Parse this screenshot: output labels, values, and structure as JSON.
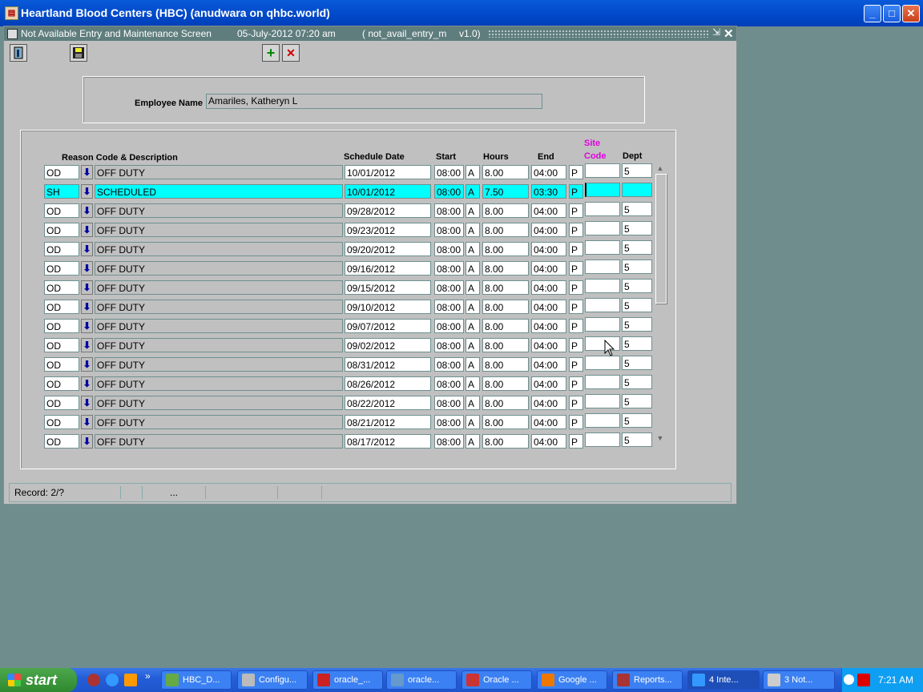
{
  "app": {
    "title": "Heartland Blood Centers (HBC) (anudwara on qhbc.world)",
    "min": "_",
    "max": "□",
    "close": "✕"
  },
  "window": {
    "screen_title": "Not Available Entry and Maintenance Screen",
    "datetime": "05-July-2012 07:20 am",
    "form_id": "( not_avail_entry_m",
    "version": "v1.0)",
    "min": "⇲",
    "close": "✕"
  },
  "toolbar": {
    "exit_icon": "exit-icon",
    "save_icon": "save-icon",
    "add": "+",
    "delete": "✕"
  },
  "employee": {
    "label": "Employee Name",
    "value": "Amariles, Katheryn L"
  },
  "headers": {
    "reason": "Reason Code & Description",
    "schedule_date": "Schedule Date",
    "start": "Start",
    "hours": "Hours",
    "end": "End",
    "site_line1": "Site",
    "site_line2": "Code",
    "dept": "Dept"
  },
  "lov_glyph": "⬇",
  "rows": [
    {
      "code": "OD",
      "desc": "OFF DUTY",
      "date": "10/01/2012",
      "start": "08:00",
      "ampm": "A",
      "hours": "8.00",
      "end": "04:00",
      "ep": "P",
      "site": "",
      "dept": "5"
    },
    {
      "code": "SH",
      "desc": "SCHEDULED",
      "date": "10/01/2012",
      "start": "08:00",
      "ampm": "A",
      "hours": "7.50",
      "end": "03:30",
      "ep": "P",
      "site": "",
      "dept": ""
    },
    {
      "code": "OD",
      "desc": "OFF DUTY",
      "date": "09/28/2012",
      "start": "08:00",
      "ampm": "A",
      "hours": "8.00",
      "end": "04:00",
      "ep": "P",
      "site": "",
      "dept": "5"
    },
    {
      "code": "OD",
      "desc": "OFF DUTY",
      "date": "09/23/2012",
      "start": "08:00",
      "ampm": "A",
      "hours": "8.00",
      "end": "04:00",
      "ep": "P",
      "site": "",
      "dept": "5"
    },
    {
      "code": "OD",
      "desc": "OFF DUTY",
      "date": "09/20/2012",
      "start": "08:00",
      "ampm": "A",
      "hours": "8.00",
      "end": "04:00",
      "ep": "P",
      "site": "",
      "dept": "5"
    },
    {
      "code": "OD",
      "desc": "OFF DUTY",
      "date": "09/16/2012",
      "start": "08:00",
      "ampm": "A",
      "hours": "8.00",
      "end": "04:00",
      "ep": "P",
      "site": "",
      "dept": "5"
    },
    {
      "code": "OD",
      "desc": "OFF DUTY",
      "date": "09/15/2012",
      "start": "08:00",
      "ampm": "A",
      "hours": "8.00",
      "end": "04:00",
      "ep": "P",
      "site": "",
      "dept": "5"
    },
    {
      "code": "OD",
      "desc": "OFF DUTY",
      "date": "09/10/2012",
      "start": "08:00",
      "ampm": "A",
      "hours": "8.00",
      "end": "04:00",
      "ep": "P",
      "site": "",
      "dept": "5"
    },
    {
      "code": "OD",
      "desc": "OFF DUTY",
      "date": "09/07/2012",
      "start": "08:00",
      "ampm": "A",
      "hours": "8.00",
      "end": "04:00",
      "ep": "P",
      "site": "",
      "dept": "5"
    },
    {
      "code": "OD",
      "desc": "OFF DUTY",
      "date": "09/02/2012",
      "start": "08:00",
      "ampm": "A",
      "hours": "8.00",
      "end": "04:00",
      "ep": "P",
      "site": "",
      "dept": "5"
    },
    {
      "code": "OD",
      "desc": "OFF DUTY",
      "date": "08/31/2012",
      "start": "08:00",
      "ampm": "A",
      "hours": "8.00",
      "end": "04:00",
      "ep": "P",
      "site": "",
      "dept": "5"
    },
    {
      "code": "OD",
      "desc": "OFF DUTY",
      "date": "08/26/2012",
      "start": "08:00",
      "ampm": "A",
      "hours": "8.00",
      "end": "04:00",
      "ep": "P",
      "site": "",
      "dept": "5"
    },
    {
      "code": "OD",
      "desc": "OFF DUTY",
      "date": "08/22/2012",
      "start": "08:00",
      "ampm": "A",
      "hours": "8.00",
      "end": "04:00",
      "ep": "P",
      "site": "",
      "dept": "5"
    },
    {
      "code": "OD",
      "desc": "OFF DUTY",
      "date": "08/21/2012",
      "start": "08:00",
      "ampm": "A",
      "hours": "8.00",
      "end": "04:00",
      "ep": "P",
      "site": "",
      "dept": "5"
    },
    {
      "code": "OD",
      "desc": "OFF DUTY",
      "date": "08/17/2012",
      "start": "08:00",
      "ampm": "A",
      "hours": "8.00",
      "end": "04:00",
      "ep": "P",
      "site": "",
      "dept": "5"
    }
  ],
  "scroll": {
    "up": "▲",
    "down": "▼"
  },
  "status": {
    "record": "Record: 2/?",
    "ellipsis": "..."
  },
  "taskbar": {
    "start": "start",
    "chevron": "»",
    "tasks": [
      "HBC_D...",
      "Configu...",
      "oracle_...",
      "oracle...",
      "Oracle ...",
      "Google ...",
      "Reports...",
      "4 Inte...",
      "3 Not..."
    ],
    "clock": "7:21 AM"
  },
  "colors": {
    "selected_row": "#00ffff",
    "site_code_header": "#e000e0",
    "desktop": "#6f8d8d"
  }
}
